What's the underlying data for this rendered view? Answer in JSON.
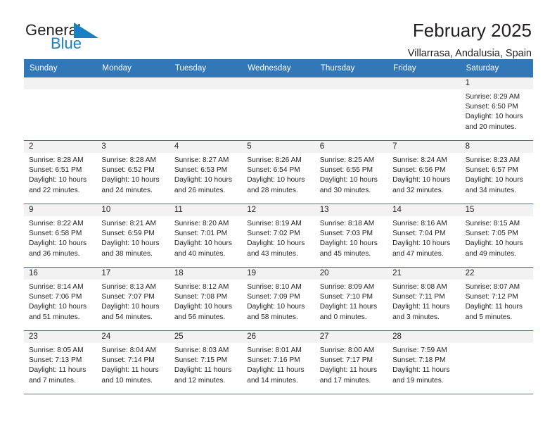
{
  "brand": {
    "name_part1": "General",
    "name_part2": "Blue",
    "triangle_color": "#1b7fc4"
  },
  "header": {
    "title": "February 2025",
    "subtitle": "Villarrasa, Andalusia, Spain"
  },
  "colors": {
    "header_blue": "#3277b8",
    "day_band_gray": "#f2f2f2",
    "text": "#231f20",
    "brand_blue": "#1b7fc4"
  },
  "weekday_headers": [
    "Sunday",
    "Monday",
    "Tuesday",
    "Wednesday",
    "Thursday",
    "Friday",
    "Saturday"
  ],
  "labels": {
    "sunrise_prefix": "Sunrise:",
    "sunset_prefix": "Sunset:",
    "daylight_prefix": "Daylight:"
  },
  "weeks": [
    [
      {
        "day": "",
        "empty": true
      },
      {
        "day": "",
        "empty": true
      },
      {
        "day": "",
        "empty": true
      },
      {
        "day": "",
        "empty": true
      },
      {
        "day": "",
        "empty": true
      },
      {
        "day": "",
        "empty": true
      },
      {
        "day": "1",
        "sunrise": "Sunrise: 8:29 AM",
        "sunset": "Sunset: 6:50 PM",
        "daylight": "Daylight: 10 hours and 20 minutes."
      }
    ],
    [
      {
        "day": "2",
        "sunrise": "Sunrise: 8:28 AM",
        "sunset": "Sunset: 6:51 PM",
        "daylight": "Daylight: 10 hours and 22 minutes."
      },
      {
        "day": "3",
        "sunrise": "Sunrise: 8:28 AM",
        "sunset": "Sunset: 6:52 PM",
        "daylight": "Daylight: 10 hours and 24 minutes."
      },
      {
        "day": "4",
        "sunrise": "Sunrise: 8:27 AM",
        "sunset": "Sunset: 6:53 PM",
        "daylight": "Daylight: 10 hours and 26 minutes."
      },
      {
        "day": "5",
        "sunrise": "Sunrise: 8:26 AM",
        "sunset": "Sunset: 6:54 PM",
        "daylight": "Daylight: 10 hours and 28 minutes."
      },
      {
        "day": "6",
        "sunrise": "Sunrise: 8:25 AM",
        "sunset": "Sunset: 6:55 PM",
        "daylight": "Daylight: 10 hours and 30 minutes."
      },
      {
        "day": "7",
        "sunrise": "Sunrise: 8:24 AM",
        "sunset": "Sunset: 6:56 PM",
        "daylight": "Daylight: 10 hours and 32 minutes."
      },
      {
        "day": "8",
        "sunrise": "Sunrise: 8:23 AM",
        "sunset": "Sunset: 6:57 PM",
        "daylight": "Daylight: 10 hours and 34 minutes."
      }
    ],
    [
      {
        "day": "9",
        "sunrise": "Sunrise: 8:22 AM",
        "sunset": "Sunset: 6:58 PM",
        "daylight": "Daylight: 10 hours and 36 minutes."
      },
      {
        "day": "10",
        "sunrise": "Sunrise: 8:21 AM",
        "sunset": "Sunset: 6:59 PM",
        "daylight": "Daylight: 10 hours and 38 minutes."
      },
      {
        "day": "11",
        "sunrise": "Sunrise: 8:20 AM",
        "sunset": "Sunset: 7:01 PM",
        "daylight": "Daylight: 10 hours and 40 minutes."
      },
      {
        "day": "12",
        "sunrise": "Sunrise: 8:19 AM",
        "sunset": "Sunset: 7:02 PM",
        "daylight": "Daylight: 10 hours and 43 minutes."
      },
      {
        "day": "13",
        "sunrise": "Sunrise: 8:18 AM",
        "sunset": "Sunset: 7:03 PM",
        "daylight": "Daylight: 10 hours and 45 minutes."
      },
      {
        "day": "14",
        "sunrise": "Sunrise: 8:16 AM",
        "sunset": "Sunset: 7:04 PM",
        "daylight": "Daylight: 10 hours and 47 minutes."
      },
      {
        "day": "15",
        "sunrise": "Sunrise: 8:15 AM",
        "sunset": "Sunset: 7:05 PM",
        "daylight": "Daylight: 10 hours and 49 minutes."
      }
    ],
    [
      {
        "day": "16",
        "sunrise": "Sunrise: 8:14 AM",
        "sunset": "Sunset: 7:06 PM",
        "daylight": "Daylight: 10 hours and 51 minutes."
      },
      {
        "day": "17",
        "sunrise": "Sunrise: 8:13 AM",
        "sunset": "Sunset: 7:07 PM",
        "daylight": "Daylight: 10 hours and 54 minutes."
      },
      {
        "day": "18",
        "sunrise": "Sunrise: 8:12 AM",
        "sunset": "Sunset: 7:08 PM",
        "daylight": "Daylight: 10 hours and 56 minutes."
      },
      {
        "day": "19",
        "sunrise": "Sunrise: 8:10 AM",
        "sunset": "Sunset: 7:09 PM",
        "daylight": "Daylight: 10 hours and 58 minutes."
      },
      {
        "day": "20",
        "sunrise": "Sunrise: 8:09 AM",
        "sunset": "Sunset: 7:10 PM",
        "daylight": "Daylight: 11 hours and 0 minutes."
      },
      {
        "day": "21",
        "sunrise": "Sunrise: 8:08 AM",
        "sunset": "Sunset: 7:11 PM",
        "daylight": "Daylight: 11 hours and 3 minutes."
      },
      {
        "day": "22",
        "sunrise": "Sunrise: 8:07 AM",
        "sunset": "Sunset: 7:12 PM",
        "daylight": "Daylight: 11 hours and 5 minutes."
      }
    ],
    [
      {
        "day": "23",
        "sunrise": "Sunrise: 8:05 AM",
        "sunset": "Sunset: 7:13 PM",
        "daylight": "Daylight: 11 hours and 7 minutes."
      },
      {
        "day": "24",
        "sunrise": "Sunrise: 8:04 AM",
        "sunset": "Sunset: 7:14 PM",
        "daylight": "Daylight: 11 hours and 10 minutes."
      },
      {
        "day": "25",
        "sunrise": "Sunrise: 8:03 AM",
        "sunset": "Sunset: 7:15 PM",
        "daylight": "Daylight: 11 hours and 12 minutes."
      },
      {
        "day": "26",
        "sunrise": "Sunrise: 8:01 AM",
        "sunset": "Sunset: 7:16 PM",
        "daylight": "Daylight: 11 hours and 14 minutes."
      },
      {
        "day": "27",
        "sunrise": "Sunrise: 8:00 AM",
        "sunset": "Sunset: 7:17 PM",
        "daylight": "Daylight: 11 hours and 17 minutes."
      },
      {
        "day": "28",
        "sunrise": "Sunrise: 7:59 AM",
        "sunset": "Sunset: 7:18 PM",
        "daylight": "Daylight: 11 hours and 19 minutes."
      },
      {
        "day": "",
        "empty": true
      }
    ]
  ]
}
